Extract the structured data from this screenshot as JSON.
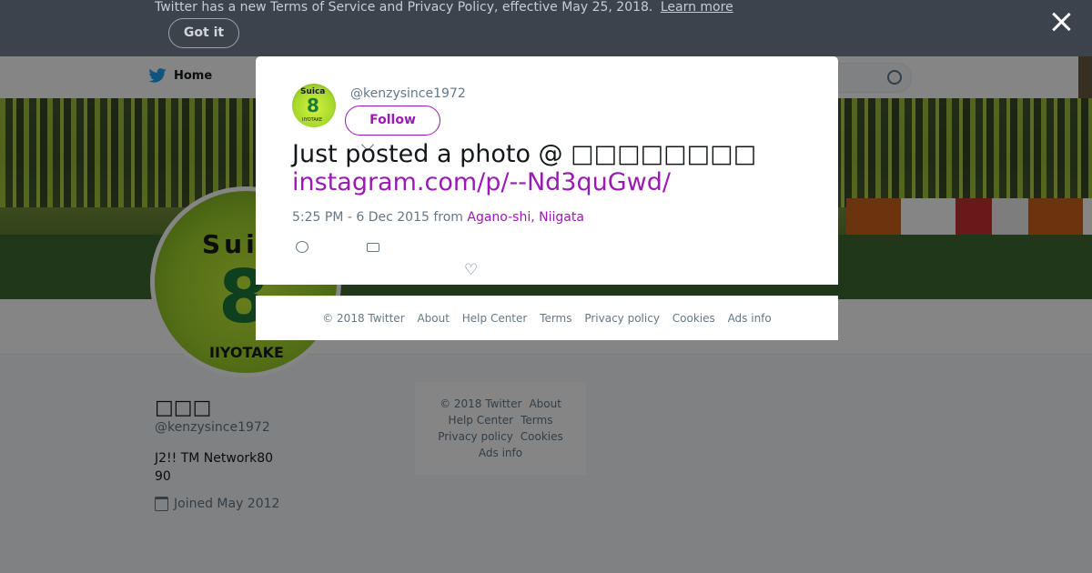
{
  "banner": {
    "text": "Twitter has a new Terms of Service and Privacy Policy, effective May 25, 2018.",
    "learn_more": "Learn more",
    "got_it": "Got it"
  },
  "nav": {
    "home": "Home"
  },
  "profile": {
    "name": "□□□",
    "handle": "@kenzysince1972",
    "bio": "J2!!  TM Network80 90",
    "joined": "Joined May 2012",
    "avatar_text": {
      "line1": "Sui",
      "line2": "8",
      "line3": "IIYOTAKE"
    }
  },
  "side_footer": [
    "© 2018 Twitter",
    "About",
    "Help Center",
    "Terms",
    "Privacy policy",
    "Cookies",
    "Ads info"
  ],
  "modal": {
    "avatar_text": {
      "line1": "Suica",
      "line2": "8",
      "line3": "IIYOTAKE"
    },
    "handle": "@kenzysince1972",
    "follow": "Follow",
    "tweet_text": "Just posted a photo @ □□□□□□□□",
    "tweet_link": "instagram.com/p/--Nd3quGwd/",
    "time": "5:25 PM - 6 Dec 2015 from ",
    "location": "Agano-shi, Niigata"
  },
  "modal_footer": [
    "© 2018 Twitter",
    "About",
    "Help Center",
    "Terms",
    "Privacy policy",
    "Cookies",
    "Ads info"
  ],
  "colors": {
    "accent": "#9b1ab6",
    "banner_bg": "#3b434c",
    "muted": "#657786"
  }
}
